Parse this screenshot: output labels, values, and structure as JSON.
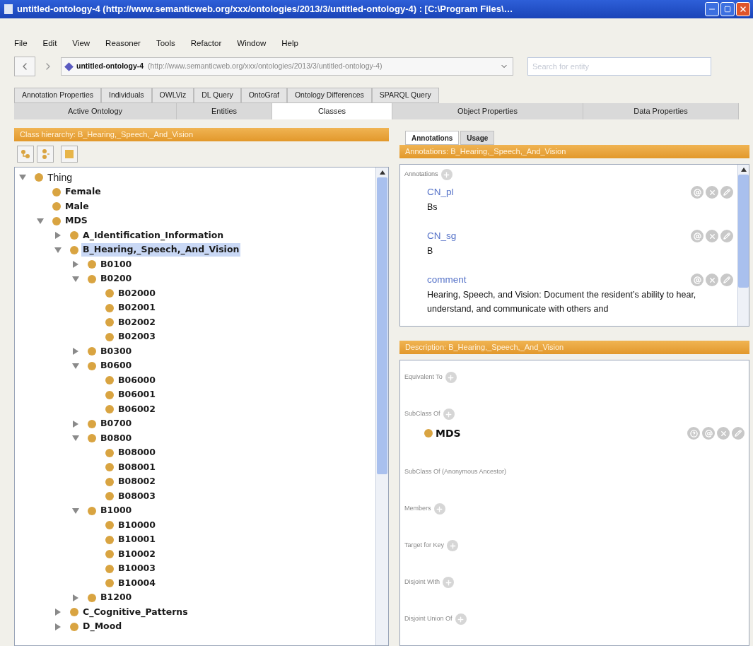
{
  "window": {
    "title": "untitled-ontology-4 (http://www.semanticweb.org/xxx/ontologies/2013/3/untitled-ontology-4) : [C:\\Program Files\\…"
  },
  "menu": [
    "File",
    "Edit",
    "View",
    "Reasoner",
    "Tools",
    "Refactor",
    "Window",
    "Help"
  ],
  "nav": {
    "ontology_name": "untitled-ontology-4",
    "ontology_iri": "(http://www.semanticweb.org/xxx/ontologies/2013/3/untitled-ontology-4)",
    "search": {
      "placeholder": "Search for entity"
    }
  },
  "tabs_top": [
    {
      "label": "Annotation Properties",
      "selected": false
    },
    {
      "label": "Individuals",
      "selected": false
    },
    {
      "label": "OWLViz",
      "selected": false
    },
    {
      "label": "DL Query",
      "selected": false
    },
    {
      "label": "OntoGraf",
      "selected": false
    },
    {
      "label": "Ontology Differences",
      "selected": false
    },
    {
      "label": "SPARQL Query",
      "selected": false
    }
  ],
  "tabs_main": [
    {
      "label": "Active Ontology",
      "selected": false
    },
    {
      "label": "Entities",
      "selected": false
    },
    {
      "label": "Classes",
      "selected": true
    },
    {
      "label": "Object Properties",
      "selected": false
    },
    {
      "label": "Data Properties",
      "selected": false
    }
  ],
  "class_hierarchy": {
    "title": "Class hierarchy: B_Hearing,_Speech,_And_Vision",
    "tree": [
      {
        "label": "Thing",
        "expanded": true,
        "selected": false,
        "children": [
          {
            "label": "Female",
            "selected": false
          },
          {
            "label": "Male",
            "selected": false
          },
          {
            "label": "MDS",
            "expanded": true,
            "selected": false,
            "children": [
              {
                "label": "A_Identification_Information",
                "expanded": false,
                "selected": false
              },
              {
                "label": "B_Hearing,_Speech,_And_Vision",
                "expanded": true,
                "selected": true,
                "children": [
                  {
                    "label": "B0100",
                    "expanded": false,
                    "selected": false
                  },
                  {
                    "label": "B0200",
                    "expanded": true,
                    "selected": false,
                    "children": [
                      {
                        "label": "B02000",
                        "selected": false
                      },
                      {
                        "label": "B02001",
                        "selected": false
                      },
                      {
                        "label": "B02002",
                        "selected": false
                      },
                      {
                        "label": "B02003",
                        "selected": false
                      }
                    ]
                  },
                  {
                    "label": "B0300",
                    "expanded": false,
                    "selected": false
                  },
                  {
                    "label": "B0600",
                    "expanded": true,
                    "selected": false,
                    "children": [
                      {
                        "label": "B06000",
                        "selected": false
                      },
                      {
                        "label": "B06001",
                        "selected": false
                      },
                      {
                        "label": "B06002",
                        "selected": false
                      }
                    ]
                  },
                  {
                    "label": "B0700",
                    "expanded": false,
                    "selected": false
                  },
                  {
                    "label": "B0800",
                    "expanded": true,
                    "selected": false,
                    "children": [
                      {
                        "label": "B08000",
                        "selected": false
                      },
                      {
                        "label": "B08001",
                        "selected": false
                      },
                      {
                        "label": "B08002",
                        "selected": false
                      },
                      {
                        "label": "B08003",
                        "selected": false
                      }
                    ]
                  },
                  {
                    "label": "B1000",
                    "expanded": true,
                    "selected": false,
                    "children": [
                      {
                        "label": "B10000",
                        "selected": false
                      },
                      {
                        "label": "B10001",
                        "selected": false
                      },
                      {
                        "label": "B10002",
                        "selected": false
                      },
                      {
                        "label": "B10003",
                        "selected": false
                      },
                      {
                        "label": "B10004",
                        "selected": false
                      }
                    ]
                  },
                  {
                    "label": "B1200",
                    "expanded": false,
                    "selected": false
                  }
                ]
              },
              {
                "label": "C_Cognitive_Patterns",
                "expanded": false,
                "selected": false
              },
              {
                "label": "D_Mood",
                "expanded": false,
                "selected": false
              }
            ]
          }
        ]
      }
    ]
  },
  "detail_tabs": [
    {
      "label": "Annotations",
      "selected": true
    },
    {
      "label": "Usage",
      "selected": false
    }
  ],
  "annotations": {
    "title": "Annotations: B_Hearing,_Speech,_And_Vision",
    "label": "Annotations",
    "items": [
      {
        "property": "CN_pl",
        "value": "Bs"
      },
      {
        "property": "CN_sg",
        "value": "B"
      },
      {
        "property": "comment",
        "value": "Hearing, Speech, and Vision: Document the resident’s ability to hear, understand, and communicate with others and"
      }
    ]
  },
  "description": {
    "title": "Description: B_Hearing,_Speech,_And_Vision",
    "sections": [
      {
        "label": "Equivalent To",
        "add": true
      },
      {
        "label": "SubClass Of",
        "add": true,
        "items": [
          "MDS"
        ]
      },
      {
        "label": "SubClass Of (Anonymous Ancestor)",
        "add": false
      },
      {
        "label": "Members",
        "add": true
      },
      {
        "label": "Target for Key",
        "add": true
      },
      {
        "label": "Disjoint With",
        "add": true
      },
      {
        "label": "Disjoint Union Of",
        "add": true
      }
    ]
  }
}
